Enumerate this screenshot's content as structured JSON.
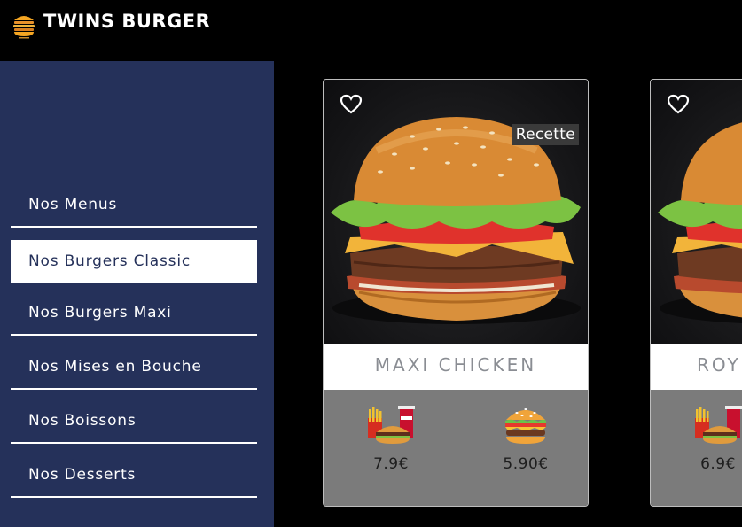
{
  "header": {
    "brand": "TWINS BURGER",
    "logo_icon": "burger-logo-icon"
  },
  "sidebar": {
    "items": [
      {
        "label": "Nos Menus",
        "active": false
      },
      {
        "label": "Nos Burgers Classic",
        "active": true
      },
      {
        "label": "Nos Burgers Maxi",
        "active": false
      },
      {
        "label": "Nos Mises en Bouche",
        "active": false
      },
      {
        "label": "Nos Boissons",
        "active": false
      },
      {
        "label": "Nos Desserts",
        "active": false
      }
    ]
  },
  "products": [
    {
      "name": "MAXI CHICKEN",
      "recette_label": "Recette",
      "menu_price": "7.9€",
      "burger_price": "5.90€"
    },
    {
      "name": "ROY",
      "menu_price": "6.9€"
    }
  ],
  "colors": {
    "sidebar_bg": "#25315a",
    "page_bg": "#000000",
    "card_footer": "#7b7b7b"
  }
}
